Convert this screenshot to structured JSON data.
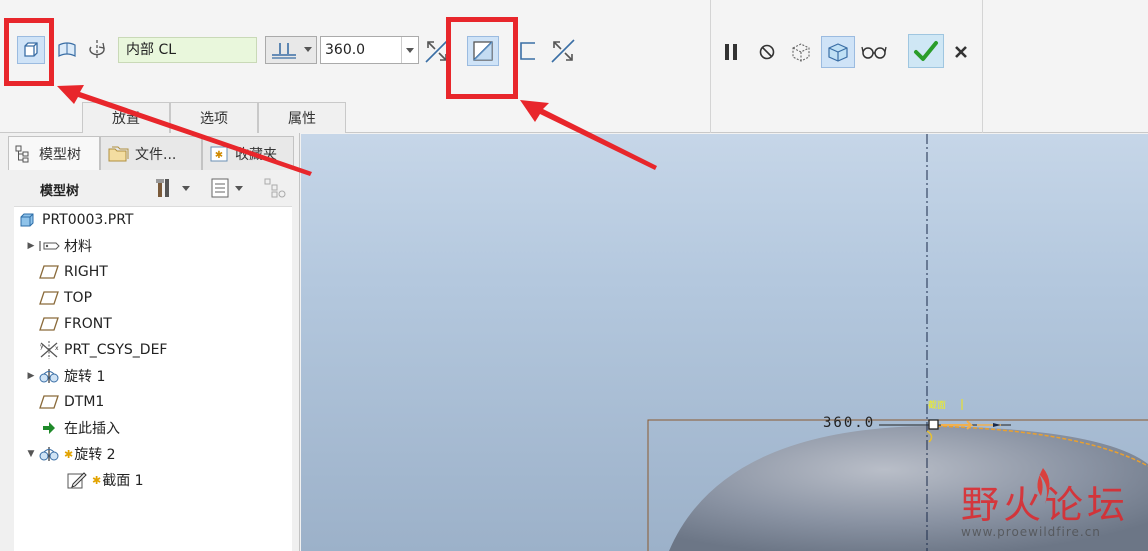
{
  "dashboard": {
    "reference_field": "内部 CL",
    "angle_value": "360.0",
    "tabs": [
      "放置",
      "选项",
      "属性"
    ]
  },
  "model_tree": {
    "panel_tabs": [
      "模型树",
      "文件...",
      "收藏夹"
    ],
    "title": "模型树",
    "items": [
      {
        "label": "PRT0003.PRT",
        "icon": "part-icon"
      },
      {
        "label": "材料",
        "icon": "material-icon"
      },
      {
        "label": "RIGHT",
        "icon": "datum-plane-icon"
      },
      {
        "label": "TOP",
        "icon": "datum-plane-icon"
      },
      {
        "label": "FRONT",
        "icon": "datum-plane-icon"
      },
      {
        "label": "PRT_CSYS_DEF",
        "icon": "csys-icon"
      },
      {
        "label": "旋转 1",
        "icon": "revolve-icon"
      },
      {
        "label": "DTM1",
        "icon": "datum-plane-icon"
      },
      {
        "label": "在此插入",
        "icon": "insert-arrow-icon"
      },
      {
        "label": "旋转 2",
        "icon": "revolve-icon"
      },
      {
        "label": "截面 1",
        "icon": "sketch-icon"
      }
    ]
  },
  "graphics": {
    "dimension_label": "360.0",
    "section_label": "截面",
    "watermark_main": "野火论坛",
    "watermark_url": "www.proewildfire.cn"
  },
  "colors": {
    "highlight": "#e8262b",
    "confirm_green": "#2a9d2a",
    "arrow_yellow": "#f0b050"
  }
}
